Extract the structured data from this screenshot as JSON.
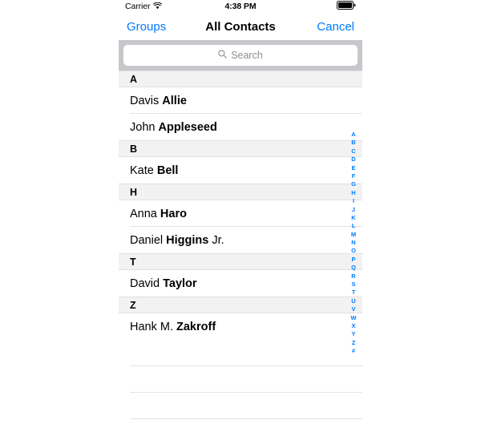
{
  "status_bar": {
    "carrier": "Carrier",
    "wifi_icon": "wifi-icon",
    "time": "4:38 PM",
    "battery_icon": "battery-full-icon"
  },
  "nav_bar": {
    "left_button": "Groups",
    "title": "All Contacts",
    "right_button": "Cancel"
  },
  "search": {
    "placeholder": "Search",
    "value": "",
    "icon": "search-icon"
  },
  "colors": {
    "accent_blue": "#007AFF",
    "search_bar_bg": "#C8C7CC",
    "section_header_bg": "#F2F2F2",
    "separator": "#E3E3E3"
  },
  "list": {
    "sections": [
      {
        "letter": "A",
        "contacts": [
          {
            "first": "Davis ",
            "last": "Allie",
            "suffix": ""
          },
          {
            "first": "John ",
            "last": "Appleseed",
            "suffix": ""
          }
        ]
      },
      {
        "letter": "B",
        "contacts": [
          {
            "first": "Kate ",
            "last": "Bell",
            "suffix": ""
          }
        ]
      },
      {
        "letter": "H",
        "contacts": [
          {
            "first": "Anna ",
            "last": "Haro",
            "suffix": ""
          },
          {
            "first": "Daniel ",
            "last": "Higgins",
            "suffix": " Jr."
          }
        ]
      },
      {
        "letter": "T",
        "contacts": [
          {
            "first": "David ",
            "last": "Taylor",
            "suffix": ""
          }
        ]
      },
      {
        "letter": "Z",
        "contacts": [
          {
            "first": "Hank M. ",
            "last": "Zakroff",
            "suffix": ""
          }
        ]
      }
    ],
    "empty_rows": 3
  },
  "index_strip": {
    "letters": [
      "A",
      "B",
      "C",
      "D",
      "E",
      "F",
      "G",
      "H",
      "I",
      "J",
      "K",
      "L",
      "M",
      "N",
      "O",
      "P",
      "Q",
      "R",
      "S",
      "T",
      "U",
      "V",
      "W",
      "X",
      "Y",
      "Z",
      "#"
    ]
  }
}
